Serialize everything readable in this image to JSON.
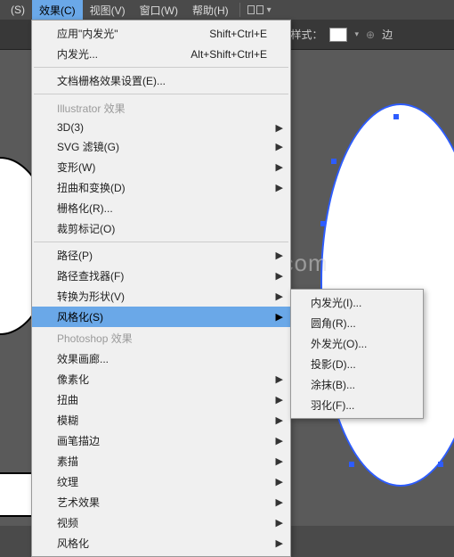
{
  "menubar": {
    "items": [
      {
        "label": "(S)"
      },
      {
        "label": "效果(C)"
      },
      {
        "label": "视图(V)"
      },
      {
        "label": "窗口(W)"
      },
      {
        "label": "帮助(H)"
      }
    ]
  },
  "toolbar": {
    "style_label": "样式：",
    "edge_label": "边"
  },
  "dropdown": {
    "recent1": {
      "label": "应用\"内发光\"",
      "shortcut": "Shift+Ctrl+E"
    },
    "recent2": {
      "label": "内发光...",
      "shortcut": "Alt+Shift+Ctrl+E"
    },
    "raster_settings": "文档栅格效果设置(E)...",
    "section_ai": "Illustrator 效果",
    "ai_items": [
      {
        "label": "3D(3)",
        "arrow": true
      },
      {
        "label": "SVG 滤镜(G)",
        "arrow": true
      },
      {
        "label": "变形(W)",
        "arrow": true
      },
      {
        "label": "扭曲和变换(D)",
        "arrow": true
      },
      {
        "label": "栅格化(R)...",
        "arrow": false
      },
      {
        "label": "裁剪标记(O)",
        "arrow": false
      },
      {
        "label": "路径(P)",
        "arrow": true
      },
      {
        "label": "路径查找器(F)",
        "arrow": true
      },
      {
        "label": "转换为形状(V)",
        "arrow": true
      },
      {
        "label": "风格化(S)",
        "arrow": true
      }
    ],
    "section_ps": "Photoshop 效果",
    "ps_items": [
      {
        "label": "效果画廊...",
        "arrow": false
      },
      {
        "label": "像素化",
        "arrow": true
      },
      {
        "label": "扭曲",
        "arrow": true
      },
      {
        "label": "模糊",
        "arrow": true
      },
      {
        "label": "画笔描边",
        "arrow": true
      },
      {
        "label": "素描",
        "arrow": true
      },
      {
        "label": "纹理",
        "arrow": true
      },
      {
        "label": "艺术效果",
        "arrow": true
      },
      {
        "label": "视频",
        "arrow": true
      },
      {
        "label": "风格化",
        "arrow": true
      }
    ]
  },
  "submenu": {
    "items": [
      "内发光(I)...",
      "圆角(R)...",
      "外发光(O)...",
      "投影(D)...",
      "涂抹(B)...",
      "羽化(F)..."
    ]
  },
  "watermark": "www.henenseo.com"
}
